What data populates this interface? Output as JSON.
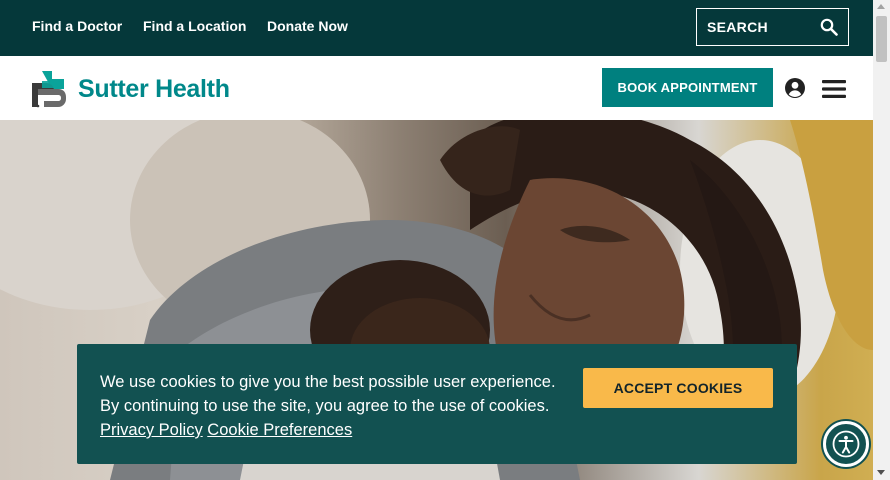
{
  "topbar": {
    "links": [
      "Find a Doctor",
      "Find a Location",
      "Donate Now"
    ],
    "search_label": "SEARCH"
  },
  "header": {
    "brand": "Sutter Health",
    "book_label": "BOOK APPOINTMENT",
    "icons": {
      "account": "account-circle-icon",
      "menu": "hamburger-menu-icon",
      "search": "search-icon"
    }
  },
  "hero": {
    "image": "mother-holding-newborn-photo"
  },
  "cookie": {
    "line1": "We use cookies to give you the best possible user experience.",
    "line2": "By continuing to use the site, you agree to the use of cookies.",
    "privacy_link": "Privacy Policy",
    "preferences_link": "Cookie Preferences",
    "accept_label": "ACCEPT COOKIES"
  },
  "colors": {
    "topbar": "#05383a",
    "brand_teal": "#00888a",
    "button_teal": "#00807f",
    "cookie_bg": "#125151",
    "accept_yellow": "#f9b94a"
  }
}
